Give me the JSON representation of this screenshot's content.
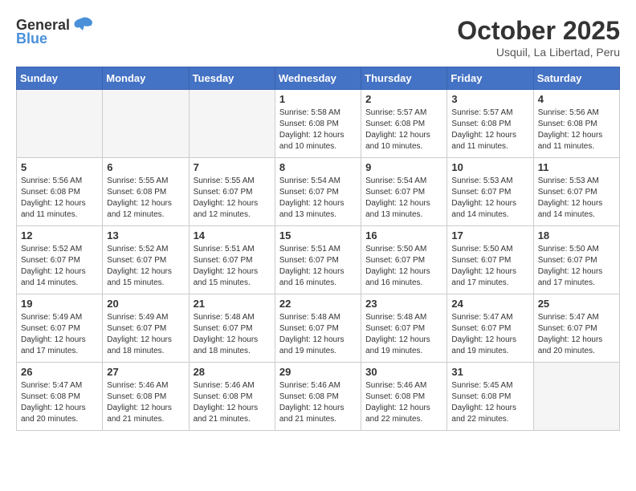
{
  "header": {
    "logo_general": "General",
    "logo_blue": "Blue",
    "month": "October 2025",
    "location": "Usquil, La Libertad, Peru"
  },
  "weekdays": [
    "Sunday",
    "Monday",
    "Tuesday",
    "Wednesday",
    "Thursday",
    "Friday",
    "Saturday"
  ],
  "weeks": [
    [
      {
        "day": "",
        "info": ""
      },
      {
        "day": "",
        "info": ""
      },
      {
        "day": "",
        "info": ""
      },
      {
        "day": "1",
        "info": "Sunrise: 5:58 AM\nSunset: 6:08 PM\nDaylight: 12 hours\nand 10 minutes."
      },
      {
        "day": "2",
        "info": "Sunrise: 5:57 AM\nSunset: 6:08 PM\nDaylight: 12 hours\nand 10 minutes."
      },
      {
        "day": "3",
        "info": "Sunrise: 5:57 AM\nSunset: 6:08 PM\nDaylight: 12 hours\nand 11 minutes."
      },
      {
        "day": "4",
        "info": "Sunrise: 5:56 AM\nSunset: 6:08 PM\nDaylight: 12 hours\nand 11 minutes."
      }
    ],
    [
      {
        "day": "5",
        "info": "Sunrise: 5:56 AM\nSunset: 6:08 PM\nDaylight: 12 hours\nand 11 minutes."
      },
      {
        "day": "6",
        "info": "Sunrise: 5:55 AM\nSunset: 6:08 PM\nDaylight: 12 hours\nand 12 minutes."
      },
      {
        "day": "7",
        "info": "Sunrise: 5:55 AM\nSunset: 6:07 PM\nDaylight: 12 hours\nand 12 minutes."
      },
      {
        "day": "8",
        "info": "Sunrise: 5:54 AM\nSunset: 6:07 PM\nDaylight: 12 hours\nand 13 minutes."
      },
      {
        "day": "9",
        "info": "Sunrise: 5:54 AM\nSunset: 6:07 PM\nDaylight: 12 hours\nand 13 minutes."
      },
      {
        "day": "10",
        "info": "Sunrise: 5:53 AM\nSunset: 6:07 PM\nDaylight: 12 hours\nand 14 minutes."
      },
      {
        "day": "11",
        "info": "Sunrise: 5:53 AM\nSunset: 6:07 PM\nDaylight: 12 hours\nand 14 minutes."
      }
    ],
    [
      {
        "day": "12",
        "info": "Sunrise: 5:52 AM\nSunset: 6:07 PM\nDaylight: 12 hours\nand 14 minutes."
      },
      {
        "day": "13",
        "info": "Sunrise: 5:52 AM\nSunset: 6:07 PM\nDaylight: 12 hours\nand 15 minutes."
      },
      {
        "day": "14",
        "info": "Sunrise: 5:51 AM\nSunset: 6:07 PM\nDaylight: 12 hours\nand 15 minutes."
      },
      {
        "day": "15",
        "info": "Sunrise: 5:51 AM\nSunset: 6:07 PM\nDaylight: 12 hours\nand 16 minutes."
      },
      {
        "day": "16",
        "info": "Sunrise: 5:50 AM\nSunset: 6:07 PM\nDaylight: 12 hours\nand 16 minutes."
      },
      {
        "day": "17",
        "info": "Sunrise: 5:50 AM\nSunset: 6:07 PM\nDaylight: 12 hours\nand 17 minutes."
      },
      {
        "day": "18",
        "info": "Sunrise: 5:50 AM\nSunset: 6:07 PM\nDaylight: 12 hours\nand 17 minutes."
      }
    ],
    [
      {
        "day": "19",
        "info": "Sunrise: 5:49 AM\nSunset: 6:07 PM\nDaylight: 12 hours\nand 17 minutes."
      },
      {
        "day": "20",
        "info": "Sunrise: 5:49 AM\nSunset: 6:07 PM\nDaylight: 12 hours\nand 18 minutes."
      },
      {
        "day": "21",
        "info": "Sunrise: 5:48 AM\nSunset: 6:07 PM\nDaylight: 12 hours\nand 18 minutes."
      },
      {
        "day": "22",
        "info": "Sunrise: 5:48 AM\nSunset: 6:07 PM\nDaylight: 12 hours\nand 19 minutes."
      },
      {
        "day": "23",
        "info": "Sunrise: 5:48 AM\nSunset: 6:07 PM\nDaylight: 12 hours\nand 19 minutes."
      },
      {
        "day": "24",
        "info": "Sunrise: 5:47 AM\nSunset: 6:07 PM\nDaylight: 12 hours\nand 19 minutes."
      },
      {
        "day": "25",
        "info": "Sunrise: 5:47 AM\nSunset: 6:07 PM\nDaylight: 12 hours\nand 20 minutes."
      }
    ],
    [
      {
        "day": "26",
        "info": "Sunrise: 5:47 AM\nSunset: 6:08 PM\nDaylight: 12 hours\nand 20 minutes."
      },
      {
        "day": "27",
        "info": "Sunrise: 5:46 AM\nSunset: 6:08 PM\nDaylight: 12 hours\nand 21 minutes."
      },
      {
        "day": "28",
        "info": "Sunrise: 5:46 AM\nSunset: 6:08 PM\nDaylight: 12 hours\nand 21 minutes."
      },
      {
        "day": "29",
        "info": "Sunrise: 5:46 AM\nSunset: 6:08 PM\nDaylight: 12 hours\nand 21 minutes."
      },
      {
        "day": "30",
        "info": "Sunrise: 5:46 AM\nSunset: 6:08 PM\nDaylight: 12 hours\nand 22 minutes."
      },
      {
        "day": "31",
        "info": "Sunrise: 5:45 AM\nSunset: 6:08 PM\nDaylight: 12 hours\nand 22 minutes."
      },
      {
        "day": "",
        "info": ""
      }
    ]
  ]
}
